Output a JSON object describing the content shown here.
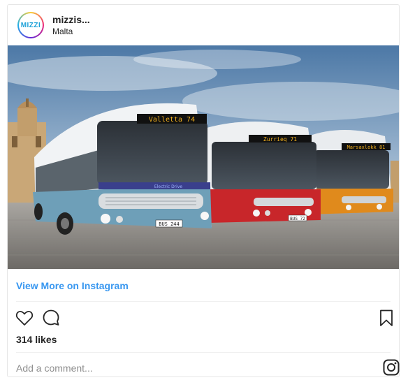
{
  "header": {
    "username": "mizzis...",
    "location": "Malta",
    "avatar_text": "MIZZI"
  },
  "photo": {
    "buses": [
      {
        "destination": "Valletta 74",
        "plate": "BUS 244",
        "side_text": "Electric Drive",
        "color": "#6e9fb8"
      },
      {
        "destination": "Zurrieq 71",
        "plate": "BUS 72",
        "color": "#c8262a"
      },
      {
        "destination": "Marsaxlokk 81",
        "color": "#e08a1c"
      }
    ]
  },
  "footer": {
    "view_more": "View More on Instagram",
    "likes": "314 likes",
    "comment_placeholder": "Add a comment..."
  },
  "colors": {
    "link": "#3897f0",
    "text": "#262626",
    "muted": "#8e8e8e"
  }
}
